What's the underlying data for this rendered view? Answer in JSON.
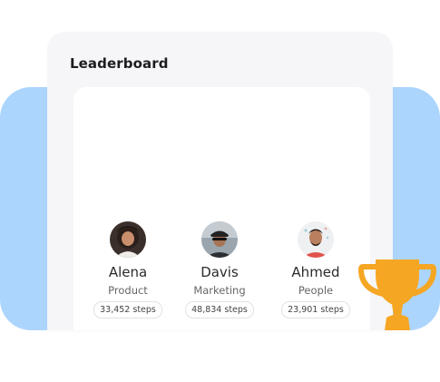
{
  "colors": {
    "backdrop": "#acd5fe",
    "trophy": "#f5a623"
  },
  "leaderboard": {
    "title": "Leaderboard",
    "entries": [
      {
        "name": "Alena",
        "department": "Product",
        "steps": "33,452 steps",
        "avatar_icon": "avatar-woman-curly-hair"
      },
      {
        "name": "Davis",
        "department": "Marketing",
        "steps": "48,834 steps",
        "avatar_icon": "avatar-man-cyclist"
      },
      {
        "name": "Ahmed",
        "department": "People",
        "steps": "23,901 steps",
        "avatar_icon": "avatar-man-red-shirt"
      }
    ]
  },
  "decoration": {
    "trophy_icon": "trophy-icon"
  }
}
